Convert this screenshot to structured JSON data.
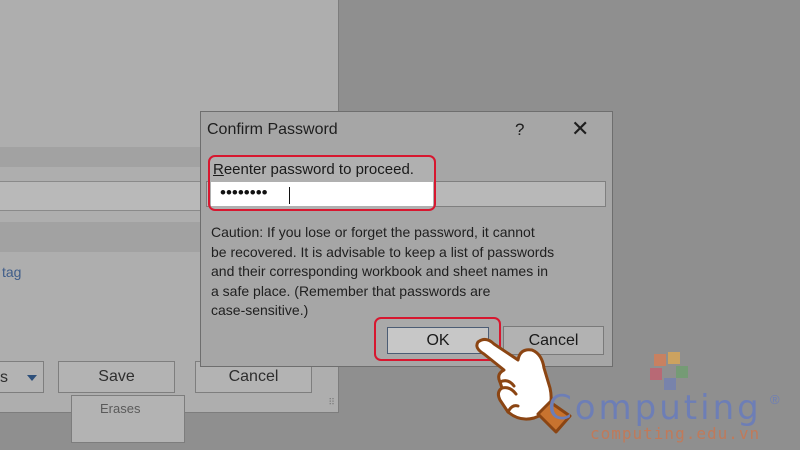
{
  "background_window": {
    "link_text": "tag",
    "dropdown_text": "s",
    "save_label": "Save",
    "cancel_label": "Cancel",
    "box_text": "Erases"
  },
  "dialog": {
    "title": "Confirm Password",
    "help_label": "?",
    "close_label": "✕",
    "prompt_first_letter": "R",
    "prompt_rest": "eenter password to proceed.",
    "password_masked": "••••••••",
    "caution_text": "Caution: If you lose or forget the password, it cannot\nbe recovered. It is advisable to keep a list of passwords\nand their corresponding workbook and sheet names in\na safe place.  (Remember that passwords are\ncase-sensitive.)",
    "ok_label": "OK",
    "cancel_label": "Cancel"
  },
  "watermark": {
    "word": "Computing",
    "registered": "®",
    "url": "computing.edu.vn"
  },
  "colors": {
    "highlight": "#d7172f",
    "hand_outline": "#8b4513",
    "watermark_blue": "#6d7eb6",
    "watermark_orange": "#c07a5a"
  }
}
